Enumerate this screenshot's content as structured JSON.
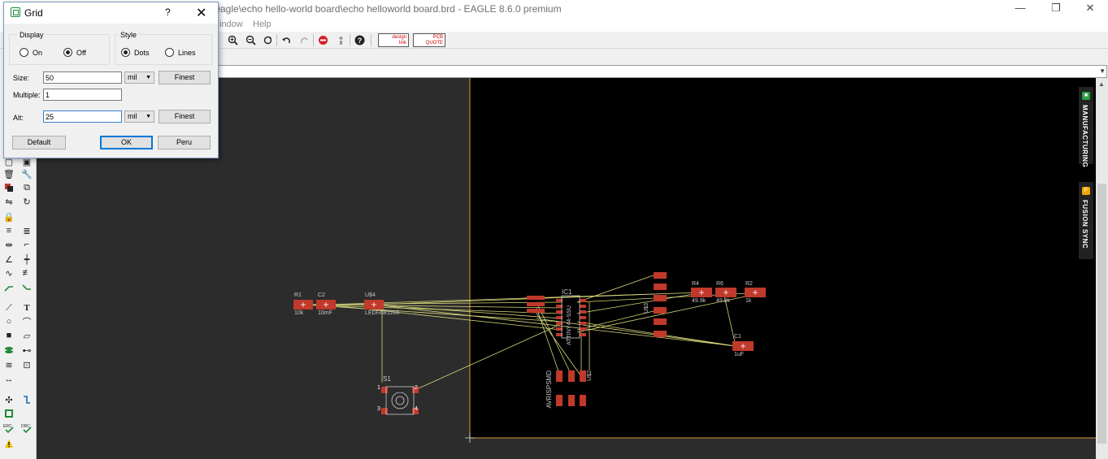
{
  "window": {
    "title": "s\\eagle\\echo hello-world board\\echo helloworld board.brd - EAGLE 8.6.0 premium",
    "minimize": "—",
    "restore": "❐",
    "close": "✕"
  },
  "menu": [
    {
      "label": "indow"
    },
    {
      "label": "Help"
    }
  ],
  "toolbar": {
    "icons": [
      "zoom-in-icon",
      "zoom-out-icon",
      "redraw-icon",
      "undo-icon",
      "redo-icon",
      "stop-icon",
      "pause-icon",
      "help-icon",
      "design-link-icon",
      "pcb-quote-icon"
    ],
    "design_link": "design\nlink",
    "pcb_quote": "PCB\nQUOTE"
  },
  "command_line": {
    "value": "",
    "dropdown": "▼"
  },
  "dialog": {
    "title": "Grid",
    "help": "?",
    "close": "✕",
    "display": {
      "label": "Display",
      "on_label": "On",
      "off_label": "Off",
      "selected": "off"
    },
    "style": {
      "label": "Style",
      "dots_label": "Dots",
      "lines_label": "Lines",
      "selected": "dots"
    },
    "size": {
      "label": "Size:",
      "value": "50",
      "unit": "mil",
      "finest": "Finest"
    },
    "multiple": {
      "label": "Multiple:",
      "value": "1"
    },
    "alt": {
      "label": "Alt:",
      "value": "25",
      "unit": "mil",
      "finest": "Finest"
    },
    "buttons": {
      "default": "Default",
      "ok": "OK",
      "peru": "Peru"
    }
  },
  "side_panels": [
    {
      "label": "MANUFACTURING",
      "color": "#2e9e44"
    },
    {
      "label": "FUSION SYNC",
      "color": "#f2a400"
    }
  ],
  "board": {
    "components": [
      {
        "ref": "R1",
        "value": "10k"
      },
      {
        "ref": "C2",
        "value": "10mF"
      },
      {
        "ref": "U$4",
        "value": "LEDFAB1206"
      },
      {
        "ref": "IC1",
        "value": "ATTINY44-SSU"
      },
      {
        "ref": "R4",
        "value": "49.9k"
      },
      {
        "ref": "R6",
        "value": "49.9k"
      },
      {
        "ref": "R2",
        "value": "1k"
      },
      {
        "ref": "C1",
        "value": "1uF"
      },
      {
        "ref": "S1",
        "value": ""
      },
      {
        "ref": "U$3",
        "value": ""
      },
      {
        "ref": "U$2",
        "value": ""
      },
      {
        "ref": "AVRISPSMD",
        "value": ""
      }
    ],
    "pin_numbers": [
      "1",
      "2",
      "3",
      "4"
    ],
    "colors": {
      "background": "#2c2c2c",
      "board_area": "#000000",
      "pad": "#c0392b",
      "airwire": "#d8d87a",
      "outline": "#d39a3a"
    }
  }
}
